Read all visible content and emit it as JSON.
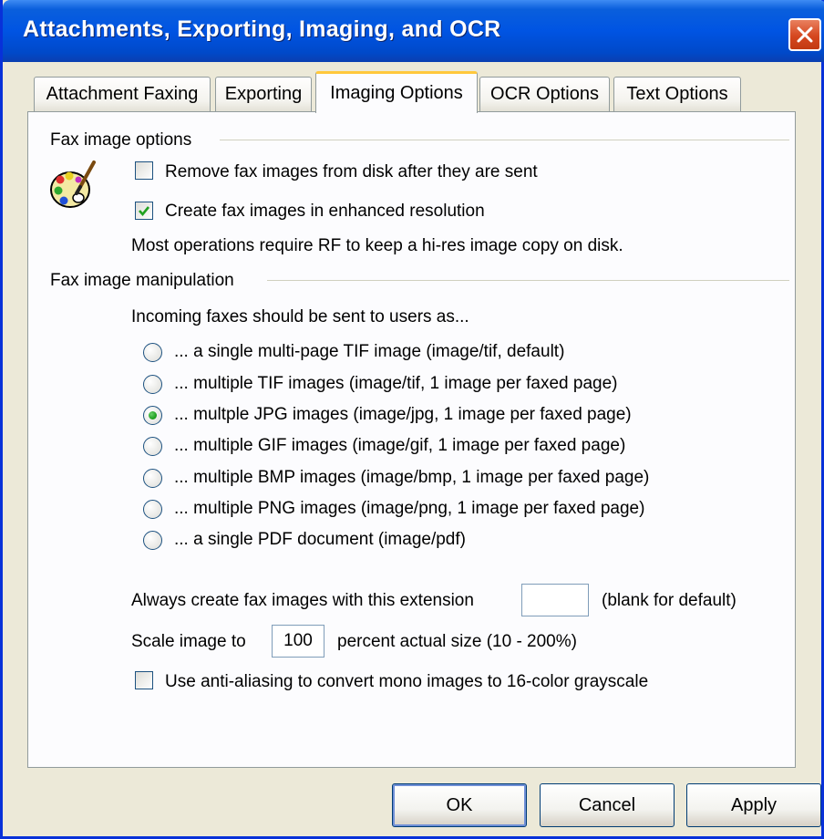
{
  "window": {
    "title": "Attachments, Exporting, Imaging, and OCR"
  },
  "tabs": [
    {
      "label": "Attachment Faxing",
      "active": false
    },
    {
      "label": "Exporting",
      "active": false
    },
    {
      "label": "Imaging Options",
      "active": true
    },
    {
      "label": "OCR Options",
      "active": false
    },
    {
      "label": "Text Options",
      "active": false
    }
  ],
  "fax_image_options": {
    "heading": "Fax image options",
    "icon": "paint-palette-icon",
    "remove_after_sent": {
      "label": "Remove fax images from disk after they are sent",
      "checked": false
    },
    "enhanced_resolution": {
      "label": "Create fax images in enhanced resolution",
      "checked": true
    },
    "note": "Most operations require RF to keep a hi-res image copy on disk."
  },
  "fax_image_manipulation": {
    "heading": "Fax image manipulation",
    "prompt": "Incoming faxes should be sent to users as...",
    "options": [
      {
        "label": "... a single multi-page TIF image (image/tif, default)",
        "selected": false
      },
      {
        "label": "... multiple TIF images (image/tif, 1 image per faxed page)",
        "selected": false
      },
      {
        "label": "... multple JPG images (image/jpg, 1 image per faxed page)",
        "selected": true
      },
      {
        "label": "... multiple GIF images (image/gif, 1 image per faxed page)",
        "selected": false
      },
      {
        "label": "... multiple BMP images (image/bmp, 1 image per faxed page)",
        "selected": false
      },
      {
        "label": "... multiple PNG images (image/png, 1 image per faxed page)",
        "selected": false
      },
      {
        "label": "... a single PDF document (image/pdf)",
        "selected": false
      }
    ],
    "extension": {
      "label": "Always create fax images with this extension",
      "value": "",
      "hint": "(blank for default)"
    },
    "scale": {
      "label": "Scale image to",
      "value": "100",
      "suffix": "percent actual size (10 - 200%)"
    },
    "anti_aliasing": {
      "label": "Use anti-aliasing to convert mono images to 16-color grayscale",
      "checked": false
    }
  },
  "buttons": {
    "ok": "OK",
    "cancel": "Cancel",
    "apply": "Apply"
  },
  "colors": {
    "title_bar": "#0054e3",
    "dialog_bg": "#ece9d8",
    "active_tab_accent": "#ffc83c",
    "radio_dot": "#21a121"
  }
}
